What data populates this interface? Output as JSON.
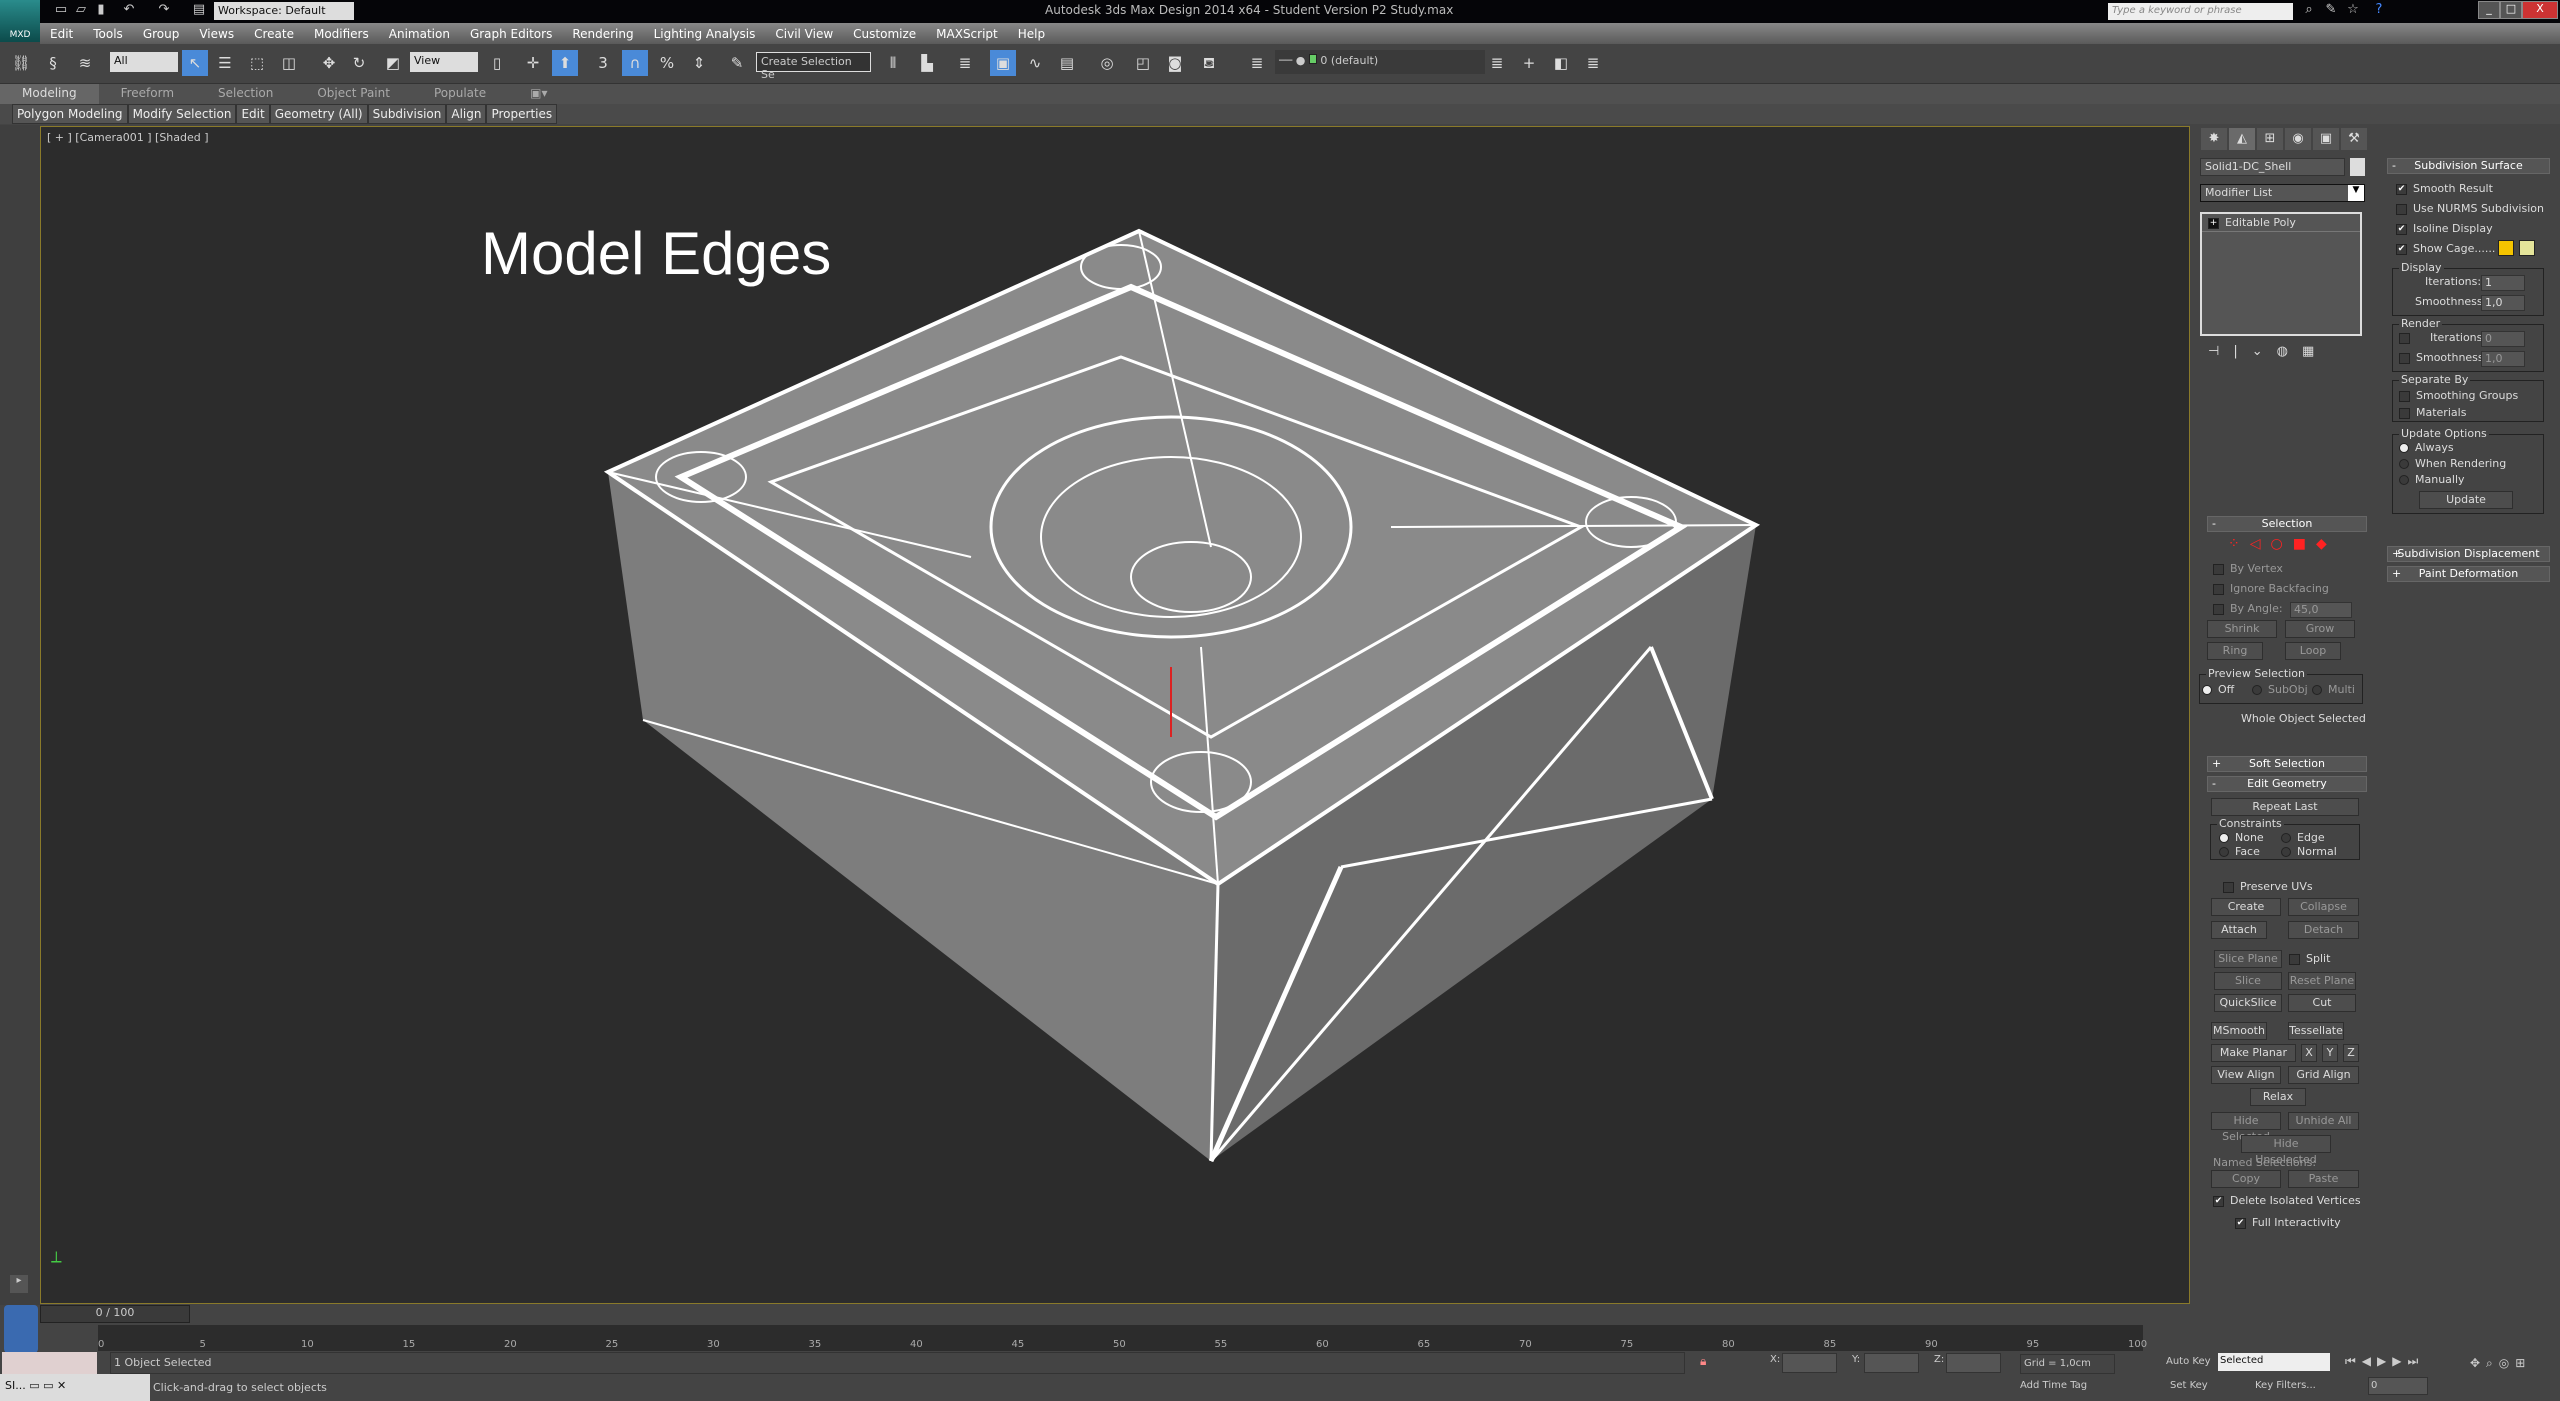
{
  "app": {
    "logo": "MXD",
    "title": "Autodesk 3ds Max Design 2014 x64 - Student Version   P2 Study.max",
    "workspace": "Workspace: Default",
    "search_placeholder": "Type a keyword or phrase",
    "window_buttons": [
      "_",
      "□",
      "X"
    ]
  },
  "menus": [
    "Edit",
    "Tools",
    "Group",
    "Views",
    "Create",
    "Modifiers",
    "Animation",
    "Graph Editors",
    "Rendering",
    "Lighting Analysis",
    "Civil View",
    "Customize",
    "MAXScript",
    "Help"
  ],
  "toolbar": {
    "selection_filter": "All",
    "reference_coord": "View",
    "snap_label": "3",
    "named_selection": "Create Selection Se",
    "layer": "0 (default)"
  },
  "ribbon": {
    "tabs": [
      "Modeling",
      "Freeform",
      "Selection",
      "Object Paint",
      "Populate"
    ],
    "active_tab": "Modeling",
    "panels": [
      "Polygon Modeling",
      "Modify Selection",
      "Edit",
      "Geometry (All)",
      "Subdivision",
      "Align",
      "Properties"
    ]
  },
  "viewport": {
    "label": "[ + ] [Camera001 ] [Shaded ]",
    "overlay_title": "Model Edges",
    "border_color": "#8a7a2a"
  },
  "command_panel": {
    "object_name": "Solid1-DC_Shell",
    "modifier_list": "Modifier List",
    "stack": [
      "Editable Poly"
    ],
    "selection": {
      "title": "Selection",
      "by_vertex": "By Vertex",
      "ignore_backfacing": "Ignore Backfacing",
      "by_angle": "By Angle:",
      "angle_value": "45,0",
      "shrink": "Shrink",
      "grow": "Grow",
      "ring": "Ring",
      "loop": "Loop",
      "preview_selection": "Preview Selection",
      "preview_options": [
        "Off",
        "SubObj",
        "Multi"
      ],
      "status": "Whole Object Selected"
    },
    "soft_selection": "Soft Selection",
    "edit_geometry": {
      "title": "Edit Geometry",
      "repeat_last": "Repeat Last",
      "constraints": "Constraints",
      "constraint_options": [
        "None",
        "Edge",
        "Face",
        "Normal"
      ],
      "preserve_uvs": "Preserve UVs",
      "create": "Create",
      "collapse": "Collapse",
      "attach": "Attach",
      "detach": "Detach",
      "slice_plane": "Slice Plane",
      "split": "Split",
      "slice": "Slice",
      "reset_plane": "Reset Plane",
      "quickslice": "QuickSlice",
      "cut": "Cut",
      "msmooth": "MSmooth",
      "tessellate": "Tessellate",
      "make_planar": "Make Planar",
      "x": "X",
      "y": "Y",
      "z": "Z",
      "view_align": "View Align",
      "grid_align": "Grid Align",
      "relax": "Relax",
      "hide_selected": "Hide Selected",
      "unhide_all": "Unhide All",
      "hide_unselected": "Hide Unselected",
      "named_selections": "Named Selections:",
      "copy": "Copy",
      "paste": "Paste",
      "delete_isolated": "Delete Isolated Vertices",
      "full_interactivity": "Full Interactivity"
    },
    "subdivision_surface": {
      "title": "Subdivision Surface",
      "smooth_result": "Smooth Result",
      "use_nurms": "Use NURMS Subdivision",
      "isoline_display": "Isoline Display",
      "show_cage": "Show Cage......",
      "cage_colors": [
        "#f5c400",
        "#e4e49a"
      ],
      "display": "Display",
      "iterations_label": "Iterations:",
      "smoothness_label": "Smoothness:",
      "display_iterations": "1",
      "display_smoothness": "1,0",
      "render": "Render",
      "render_iterations": "0",
      "render_smoothness": "1,0",
      "separate_by": "Separate By",
      "smoothing_groups": "Smoothing Groups",
      "materials": "Materials",
      "update_options": "Update Options",
      "update_choices": [
        "Always",
        "When Rendering",
        "Manually"
      ],
      "update": "Update"
    },
    "subdivision_displacement": "Subdivision Displacement",
    "paint_deformation": "Paint Deformation"
  },
  "timeline": {
    "slider": "0 / 100",
    "ticks": [
      "0",
      "5",
      "10",
      "15",
      "20",
      "25",
      "30",
      "35",
      "40",
      "45",
      "50",
      "55",
      "60",
      "65",
      "70",
      "75",
      "80",
      "85",
      "90",
      "95",
      "100"
    ]
  },
  "status": {
    "selected": "1 Object Selected",
    "prompt": "Click-and-drag to select objects",
    "x": "X:",
    "y": "Y:",
    "z": "Z:",
    "grid": "Grid = 1,0cm",
    "add_time_tag": "Add Time Tag",
    "auto_key": "Auto Key",
    "set_key": "Set Key",
    "key_mode": "Selected",
    "key_filters": "Key Filters...",
    "frame": "0",
    "taskbar_item": "SI..."
  }
}
